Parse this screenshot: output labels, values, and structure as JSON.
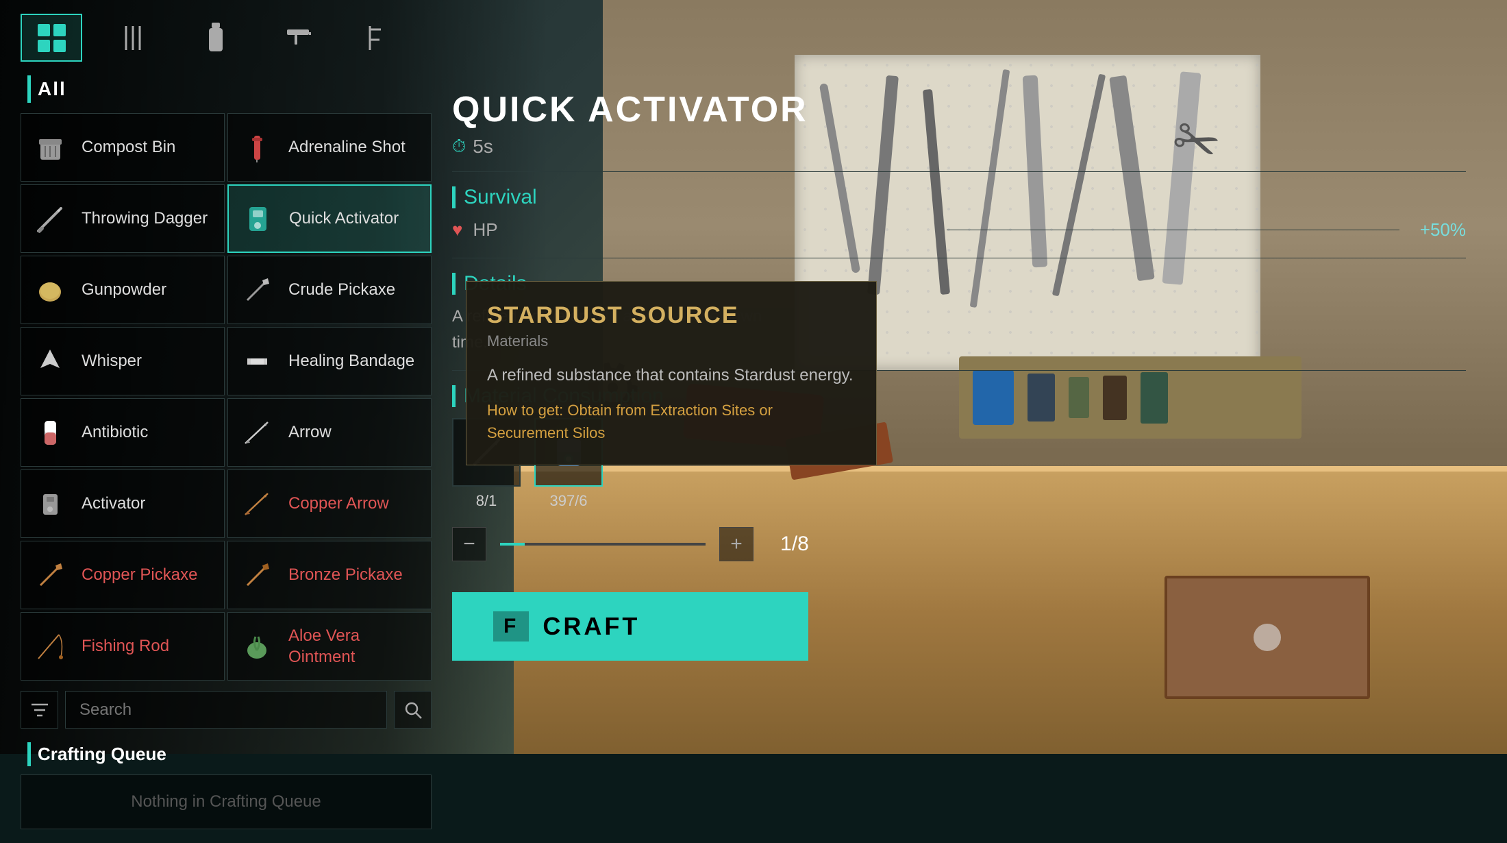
{
  "nav": {
    "tabs": [
      {
        "id": "all",
        "label": "⊞",
        "icon": "grid-icon",
        "active": true
      },
      {
        "id": "tools",
        "label": "🔧",
        "icon": "tool-icon",
        "active": false
      },
      {
        "id": "consumables",
        "label": "🧪",
        "icon": "bottle-icon",
        "active": false
      },
      {
        "id": "weapons",
        "label": "🔫",
        "icon": "gun-icon",
        "active": false
      },
      {
        "id": "resources",
        "label": "⚙",
        "icon": "gear-icon",
        "active": false
      }
    ]
  },
  "category": {
    "label": "All"
  },
  "items": [
    {
      "id": "compost-bin",
      "name": "Compost Bin",
      "icon": "🗑",
      "available": true,
      "selected": false,
      "col": 0
    },
    {
      "id": "adrenaline-shot",
      "name": "Adrenaline Shot",
      "icon": "💉",
      "available": true,
      "selected": false,
      "col": 1
    },
    {
      "id": "throwing-dagger",
      "name": "Throwing Dagger",
      "icon": "🗡",
      "available": true,
      "selected": false,
      "col": 0
    },
    {
      "id": "quick-activator",
      "name": "Quick Activator",
      "icon": "⚡",
      "available": true,
      "selected": true,
      "col": 1
    },
    {
      "id": "gunpowder",
      "name": "Gunpowder",
      "icon": "🌾",
      "available": true,
      "selected": false,
      "col": 0
    },
    {
      "id": "crude-pickaxe",
      "name": "Crude Pickaxe",
      "icon": "⛏",
      "available": true,
      "selected": false,
      "col": 1
    },
    {
      "id": "whisper",
      "name": "Whisper",
      "icon": "▽",
      "available": true,
      "selected": false,
      "col": 0
    },
    {
      "id": "healing-bandage",
      "name": "Healing Bandage",
      "icon": "🩹",
      "available": true,
      "selected": false,
      "col": 1
    },
    {
      "id": "antibiotic",
      "name": "Antibiotic",
      "icon": "💊",
      "available": true,
      "selected": false,
      "col": 0
    },
    {
      "id": "arrow",
      "name": "Arrow",
      "icon": "↗",
      "available": true,
      "selected": false,
      "col": 1
    },
    {
      "id": "activator",
      "name": "Activator",
      "icon": "🔧",
      "available": true,
      "selected": false,
      "col": 0
    },
    {
      "id": "copper-arrow",
      "name": "Copper Arrow",
      "icon": "↗",
      "available": false,
      "selected": false,
      "col": 1
    },
    {
      "id": "copper-pickaxe",
      "name": "Copper Pickaxe",
      "icon": "⛏",
      "available": false,
      "selected": false,
      "col": 0
    },
    {
      "id": "bronze-pickaxe",
      "name": "Bronze Pickaxe",
      "icon": "⛏",
      "available": false,
      "selected": false,
      "col": 1
    },
    {
      "id": "fishing-rod",
      "name": "Fishing Rod",
      "icon": "🎣",
      "available": false,
      "selected": false,
      "col": 0
    },
    {
      "id": "aloe-vera-ointment",
      "name": "Aloe Vera Ointment",
      "icon": "🌿",
      "available": false,
      "selected": false,
      "col": 1
    }
  ],
  "search": {
    "placeholder": "Search",
    "value": ""
  },
  "crafting_queue": {
    "label": "Crafting Queue",
    "empty_message": "Nothing in Crafting Queue"
  },
  "detail": {
    "title": "QUICK ACTIVATOR",
    "cooldown": "5s",
    "section_survival": "Survival",
    "stat_hp_label": "HP",
    "stat_hp_value": "+50%",
    "section_details": "Details",
    "description": "A refined Activator with a shorter cooldown time.",
    "section_material": "Material Consumption",
    "materials": [
      {
        "name": "Stick",
        "icon": "🔨",
        "count": "8/1",
        "selected": false
      },
      {
        "name": "Stardust Source",
        "icon": "✨",
        "count": "397/6",
        "selected": true
      }
    ],
    "quantity": {
      "current": 1,
      "max": 8,
      "display": "1/8"
    }
  },
  "craft_button": {
    "key": "F",
    "label": "CRAFT"
  },
  "tooltip": {
    "title": "STARDUST SOURCE",
    "category": "Materials",
    "description": "A refined substance that contains Stardust energy.",
    "howto": "How to get: Obtain from Extraction Sites or Securement Silos"
  }
}
